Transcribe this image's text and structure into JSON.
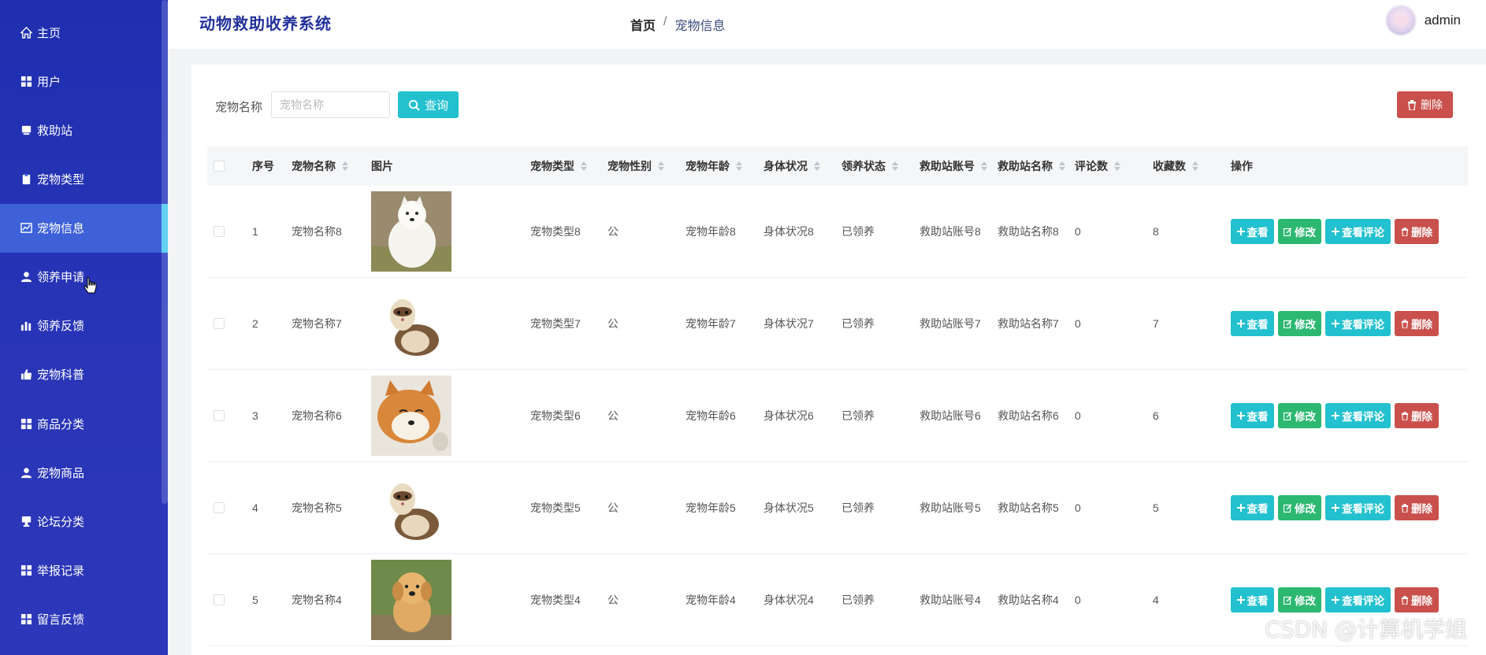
{
  "app": {
    "title": "动物救助收养系统"
  },
  "breadcrumb": {
    "home": "首页",
    "separator": "/",
    "current": "宠物信息"
  },
  "user": {
    "name": "admin"
  },
  "sidebar": {
    "items": [
      {
        "label": "主页",
        "icon": "home-icon"
      },
      {
        "label": "用户",
        "icon": "grid-icon"
      },
      {
        "label": "救助站",
        "icon": "card-icon"
      },
      {
        "label": "宠物类型",
        "icon": "clipboard-icon"
      },
      {
        "label": "宠物信息",
        "icon": "chart-icon",
        "active": true
      },
      {
        "label": "领养申请",
        "icon": "user-icon"
      },
      {
        "label": "领养反馈",
        "icon": "bar-chart-icon"
      },
      {
        "label": "宠物科普",
        "icon": "thumbs-up-icon"
      },
      {
        "label": "商品分类",
        "icon": "grid-icon"
      },
      {
        "label": "宠物商品",
        "icon": "user-icon"
      },
      {
        "label": "论坛分类",
        "icon": "cup-icon"
      },
      {
        "label": "举报记录",
        "icon": "grid-icon"
      },
      {
        "label": "留言反馈",
        "icon": "grid-icon"
      }
    ]
  },
  "search": {
    "label": "宠物名称",
    "placeholder": "宠物名称",
    "value": "",
    "query_label": "查询"
  },
  "toolbar": {
    "delete_label": "删除"
  },
  "table": {
    "headers": {
      "index": "序号",
      "name": "宠物名称",
      "image": "图片",
      "type": "宠物类型",
      "gender": "宠物性别",
      "age": "宠物年龄",
      "health": "身体状况",
      "adopt": "领养状态",
      "station_account": "救助站账号",
      "station_name": "救助站名称",
      "comments": "评论数",
      "favorites": "收藏数",
      "actions": "操作"
    },
    "actions": {
      "view": "查看",
      "edit": "修改",
      "comment": "查看评论",
      "delete": "删除"
    },
    "rows": [
      {
        "index": "1",
        "name": "宠物名称8",
        "image": "samoyed",
        "type": "宠物类型8",
        "gender": "公",
        "age": "宠物年龄8",
        "health": "身体状况8",
        "adopt": "已领养",
        "station_account": "救助站账号8",
        "station_name": "救助站名称8",
        "comments": "0",
        "favorites": "8"
      },
      {
        "index": "2",
        "name": "宠物名称7",
        "image": "ferret",
        "type": "宠物类型7",
        "gender": "公",
        "age": "宠物年龄7",
        "health": "身体状况7",
        "adopt": "已领养",
        "station_account": "救助站账号7",
        "station_name": "救助站名称7",
        "comments": "0",
        "favorites": "7"
      },
      {
        "index": "3",
        "name": "宠物名称6",
        "image": "shiba",
        "type": "宠物类型6",
        "gender": "公",
        "age": "宠物年龄6",
        "health": "身体状况6",
        "adopt": "已领养",
        "station_account": "救助站账号6",
        "station_name": "救助站名称6",
        "comments": "0",
        "favorites": "6"
      },
      {
        "index": "4",
        "name": "宠物名称5",
        "image": "ferret",
        "type": "宠物类型5",
        "gender": "公",
        "age": "宠物年龄5",
        "health": "身体状况5",
        "adopt": "已领养",
        "station_account": "救助站账号5",
        "station_name": "救助站名称5",
        "comments": "0",
        "favorites": "5"
      },
      {
        "index": "5",
        "name": "宠物名称4",
        "image": "golden-puppy",
        "type": "宠物类型4",
        "gender": "公",
        "age": "宠物年龄4",
        "health": "身体状况4",
        "adopt": "已领养",
        "station_account": "救助站账号4",
        "station_name": "救助站名称4",
        "comments": "0",
        "favorites": "4"
      }
    ]
  },
  "watermark": "CSDN @计算机学姐"
}
